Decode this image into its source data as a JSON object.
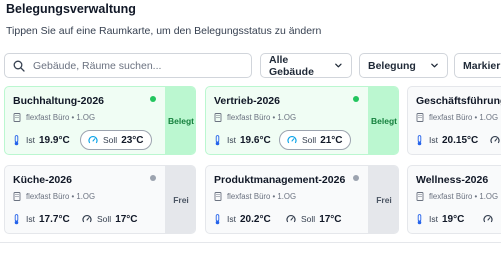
{
  "header": {
    "title": "Belegungsverwaltung",
    "subtitle": "Tippen Sie auf eine Raumkarte, um den Belegungsstatus zu ändern"
  },
  "toolbar": {
    "search_placeholder": "Gebäude, Räume suchen...",
    "search_value": "",
    "building_filter": "Alle Gebäude",
    "occupancy_filter": "Belegung",
    "mark_filter": "Markieru"
  },
  "labels": {
    "actual": "Ist",
    "target": "Soll"
  },
  "colors": {
    "occupied_accent": "#22c55e",
    "free_accent": "#9ca3af"
  },
  "rooms": [
    {
      "name": "Buchhaltung-2026",
      "location": "flexfast Büro • 1.OG",
      "ist": "19.9°C",
      "soll": "23°C",
      "status": "Belegt",
      "occupied": true
    },
    {
      "name": "Vertrieb-2026",
      "location": "flexfast Büro • 1.OG",
      "ist": "19.6°C",
      "soll": "21°C",
      "status": "Belegt",
      "occupied": true
    },
    {
      "name": "Geschäftsführung-…",
      "location": "flexfast Büro • 1.OG",
      "ist": "20.15°C",
      "soll": "",
      "status": "",
      "occupied": false
    },
    {
      "name": "Küche-2026",
      "location": "flexfast Büro • 1.OG",
      "ist": "17.7°C",
      "soll": "17°C",
      "status": "Frei",
      "occupied": false
    },
    {
      "name": "Produktmanagement-2026",
      "location": "flexfast Büro • 1.OG",
      "ist": "20.2°C",
      "soll": "17°C",
      "status": "Frei",
      "occupied": false
    },
    {
      "name": "Wellness-2026",
      "location": "flexfast Büro • 1.OG",
      "ist": "19°C",
      "soll": "",
      "status": "",
      "occupied": false
    }
  ]
}
